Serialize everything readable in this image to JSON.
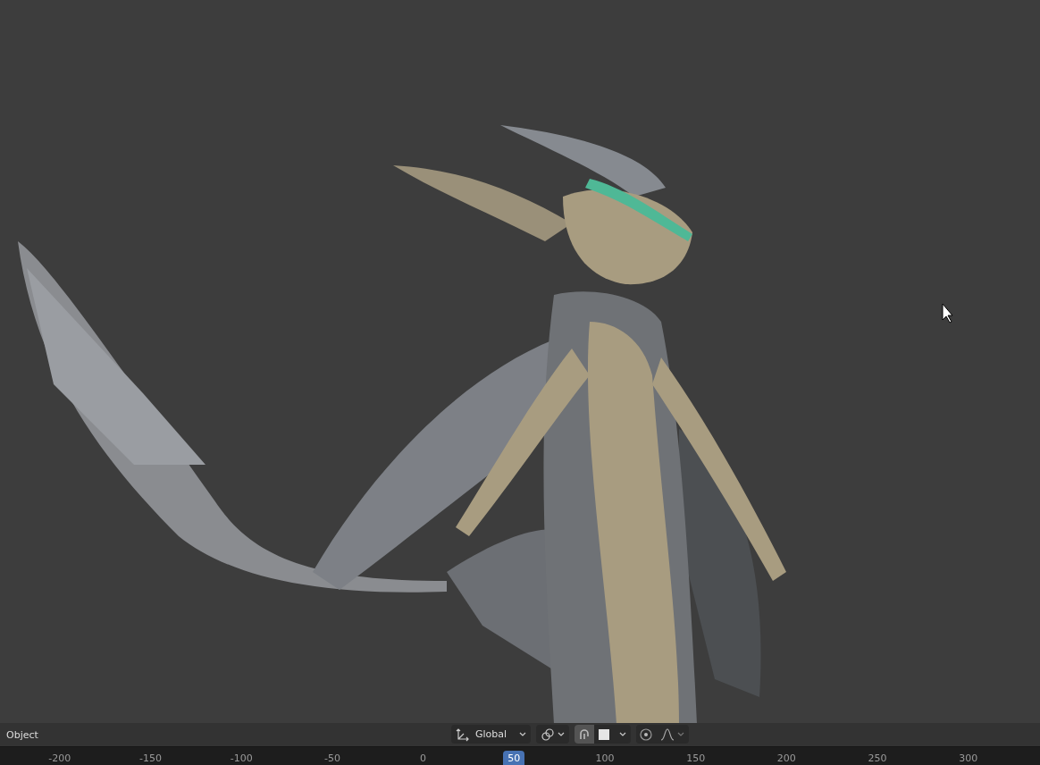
{
  "header_bar": {
    "mode": "Object",
    "transform_orientation": "Global",
    "snapping": {
      "on": true
    },
    "proportional_editing": {
      "on": false
    }
  },
  "timeline": {
    "ticks": [
      {
        "label": "-200",
        "selected": false
      },
      {
        "label": "-150",
        "selected": false
      },
      {
        "label": "-100",
        "selected": false
      },
      {
        "label": "-50",
        "selected": false
      },
      {
        "label": "0",
        "selected": false
      },
      {
        "label": "50",
        "selected": true
      },
      {
        "label": "100",
        "selected": false
      },
      {
        "label": "150",
        "selected": false
      },
      {
        "label": "200",
        "selected": false
      },
      {
        "label": "250",
        "selected": false
      },
      {
        "label": "300",
        "selected": false
      }
    ]
  }
}
